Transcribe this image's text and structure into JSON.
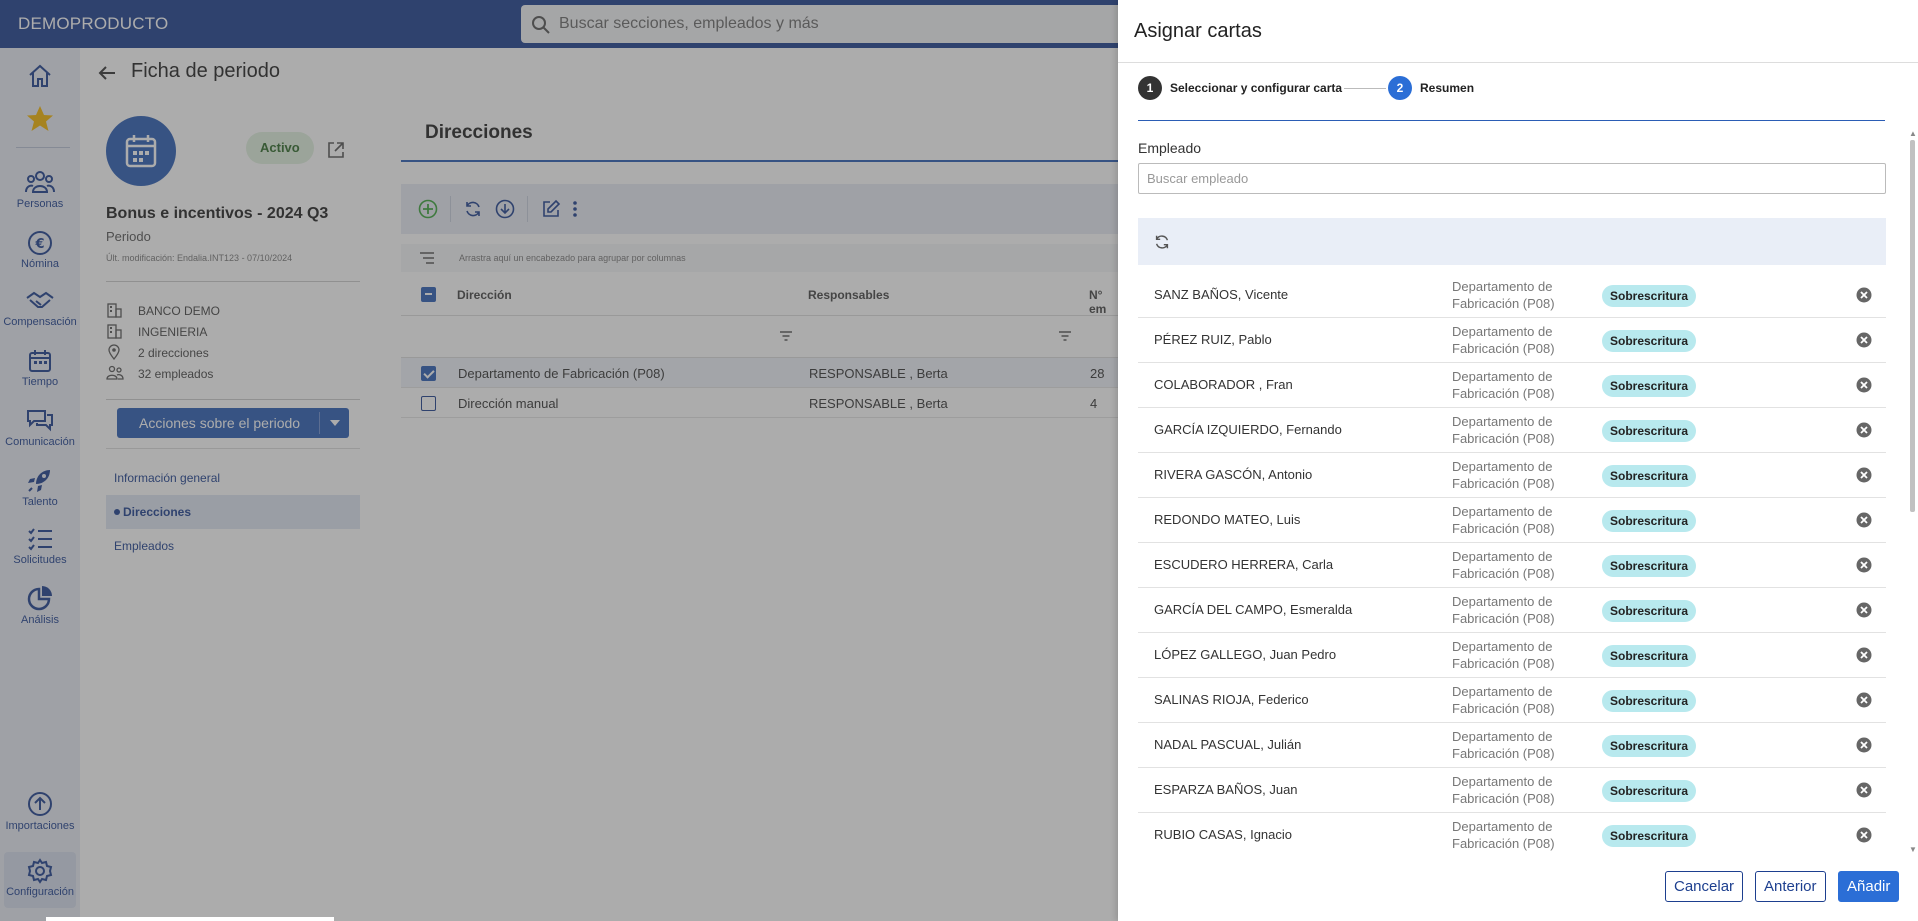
{
  "app": {
    "brand": "DEMOPRODUCTO"
  },
  "search": {
    "placeholder": "Buscar secciones, empleados y más"
  },
  "nav": {
    "items": [
      {
        "label": "Personas",
        "icon": "people-icon"
      },
      {
        "label": "Nómina",
        "icon": "euro-icon"
      },
      {
        "label": "Compensación",
        "icon": "handshake-icon"
      },
      {
        "label": "Tiempo",
        "icon": "calendar-icon"
      },
      {
        "label": "Comunicación",
        "icon": "chat-icon"
      },
      {
        "label": "Talento",
        "icon": "rocket-icon"
      },
      {
        "label": "Solicitudes",
        "icon": "checklist-icon"
      },
      {
        "label": "Análisis",
        "icon": "pie-chart-icon"
      },
      {
        "label": "Importaciones",
        "icon": "upload-icon"
      },
      {
        "label": "Configuración",
        "icon": "gear-icon"
      }
    ]
  },
  "page": {
    "title": "Ficha de periodo",
    "status": "Activo",
    "period_name": "Bonus e incentivos - 2024 Q3",
    "period_type": "Periodo",
    "last_modified": "Últ. modificación: Endalia.INT123 - 07/10/2024",
    "info": [
      {
        "icon": "building-icon",
        "text": "BANCO DEMO"
      },
      {
        "icon": "building-icon",
        "text": "INGENIERIA"
      },
      {
        "icon": "location-icon",
        "text": "2 direcciones"
      },
      {
        "icon": "people-icon",
        "text": "32 empleados"
      }
    ],
    "actions_label": "Acciones sobre el periodo",
    "side_links": [
      "Información general",
      "Direcciones",
      "Empleados"
    ],
    "section_title": "Direcciones",
    "group_hint": "Arrastra aquí un encabezado para agrupar por columnas",
    "grid": {
      "headers": [
        "Dirección",
        "Responsables",
        "N° em"
      ],
      "rows": [
        {
          "direccion": "Departamento de Fabricación (P08)",
          "responsables": "RESPONSABLE , Berta",
          "num": "28",
          "selected": true
        },
        {
          "direccion": "Dirección manual",
          "responsables": "RESPONSABLE , Berta",
          "num": "4",
          "selected": false
        }
      ]
    }
  },
  "drawer": {
    "title": "Asignar cartas",
    "steps": [
      {
        "num": "1",
        "label": "Seleccionar y configurar carta"
      },
      {
        "num": "2",
        "label": "Resumen"
      }
    ],
    "employee_label": "Empleado",
    "employee_placeholder": "Buscar empleado",
    "rows": [
      {
        "name": "SANZ BAÑOS, Vicente",
        "dept1": "Departamento de",
        "dept2": "Fabricación (P08)",
        "badge": "Sobrescritura"
      },
      {
        "name": "PÉREZ RUIZ, Pablo",
        "dept1": "Departamento de",
        "dept2": "Fabricación (P08)",
        "badge": "Sobrescritura"
      },
      {
        "name": "COLABORADOR , Fran",
        "dept1": "Departamento de",
        "dept2": "Fabricación (P08)",
        "badge": "Sobrescritura"
      },
      {
        "name": "GARCÍA IZQUIERDO, Fernando",
        "dept1": "Departamento de",
        "dept2": "Fabricación (P08)",
        "badge": "Sobrescritura"
      },
      {
        "name": "RIVERA GASCÓN, Antonio",
        "dept1": "Departamento de",
        "dept2": "Fabricación (P08)",
        "badge": "Sobrescritura"
      },
      {
        "name": "REDONDO MATEO, Luis",
        "dept1": "Departamento de",
        "dept2": "Fabricación (P08)",
        "badge": "Sobrescritura"
      },
      {
        "name": "ESCUDERO HERRERA, Carla",
        "dept1": "Departamento de",
        "dept2": "Fabricación (P08)",
        "badge": "Sobrescritura"
      },
      {
        "name": "GARCÍA DEL CAMPO, Esmeralda",
        "dept1": "Departamento de",
        "dept2": "Fabricación (P08)",
        "badge": "Sobrescritura"
      },
      {
        "name": "LÓPEZ GALLEGO, Juan Pedro",
        "dept1": "Departamento de",
        "dept2": "Fabricación (P08)",
        "badge": "Sobrescritura"
      },
      {
        "name": "SALINAS RIOJA, Federico",
        "dept1": "Departamento de",
        "dept2": "Fabricación (P08)",
        "badge": "Sobrescritura"
      },
      {
        "name": "NADAL PASCUAL, Julián",
        "dept1": "Departamento de",
        "dept2": "Fabricación (P08)",
        "badge": "Sobrescritura"
      },
      {
        "name": "ESPARZA BAÑOS, Juan",
        "dept1": "Departamento de",
        "dept2": "Fabricación (P08)",
        "badge": "Sobrescritura"
      },
      {
        "name": "RUBIO CASAS, Ignacio",
        "dept1": "Departamento de",
        "dept2": "Fabricación (P08)",
        "badge": "Sobrescritura"
      }
    ],
    "footer": {
      "cancel": "Cancelar",
      "previous": "Anterior",
      "add": "Añadir"
    }
  },
  "colors": {
    "brand": "#1d3f8f",
    "primary": "#2b5db5",
    "badge_bg": "#b8e9ee",
    "active_bg": "#e1f0df"
  }
}
